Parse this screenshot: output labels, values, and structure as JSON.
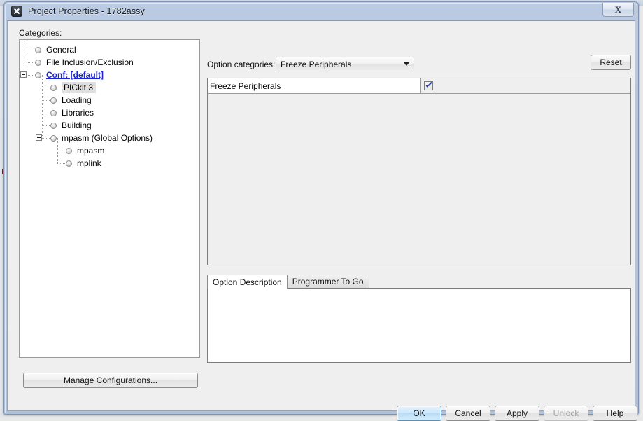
{
  "window": {
    "title": "Project Properties - 1782assy",
    "app_icon": "x-app-icon",
    "close_label": "✕",
    "close_glyph": "X"
  },
  "left_pane": {
    "categories_label": "Categories:",
    "manage_configurations_label": "Manage Configurations...",
    "tree": [
      {
        "label": "General",
        "depth": 1,
        "state": "normal",
        "expander": false
      },
      {
        "label": "File Inclusion/Exclusion",
        "depth": 1,
        "state": "normal",
        "expander": false
      },
      {
        "label": "Conf: [default]",
        "depth": 1,
        "state": "link",
        "expander": true
      },
      {
        "label": "PICkit 3",
        "depth": 2,
        "state": "selected",
        "expander": false
      },
      {
        "label": "Loading",
        "depth": 2,
        "state": "normal",
        "expander": false
      },
      {
        "label": "Libraries",
        "depth": 2,
        "state": "normal",
        "expander": false
      },
      {
        "label": "Building",
        "depth": 2,
        "state": "normal",
        "expander": false
      },
      {
        "label": "mpasm (Global Options)",
        "depth": 2,
        "state": "normal",
        "expander": true
      },
      {
        "label": "mpasm",
        "depth": 3,
        "state": "normal",
        "expander": false
      },
      {
        "label": "mplink",
        "depth": 3,
        "state": "normal",
        "expander": false
      }
    ]
  },
  "right_pane": {
    "option_categories_label": "Option categories:",
    "option_categories_value": "Freeze Peripherals",
    "option_categories_options": [
      "Freeze Peripherals"
    ],
    "reset_label": "Reset",
    "options": [
      {
        "name": "Freeze Peripherals",
        "type": "checkbox",
        "checked": true
      }
    ],
    "tabs": [
      {
        "label": "Option Description",
        "active": true
      },
      {
        "label": "Programmer To Go",
        "active": false
      }
    ],
    "description_text": ""
  },
  "footer": {
    "buttons": [
      {
        "id": "ok-button",
        "label": "OK",
        "default": true,
        "disabled": false
      },
      {
        "id": "cancel-button",
        "label": "Cancel",
        "default": false,
        "disabled": false
      },
      {
        "id": "apply-button",
        "label": "Apply",
        "default": false,
        "disabled": false
      },
      {
        "id": "unlock-button",
        "label": "Unlock",
        "default": false,
        "disabled": true
      },
      {
        "id": "help-button",
        "label": "Help",
        "default": false,
        "disabled": false
      }
    ]
  },
  "colors": {
    "titlebar_top": "#bacbe2",
    "titlebar_bottom": "#aec1db",
    "client_bg": "#efefef",
    "link": "#1a24d8",
    "check": "#2a3ea8",
    "default_button": "#b9dcf6"
  }
}
